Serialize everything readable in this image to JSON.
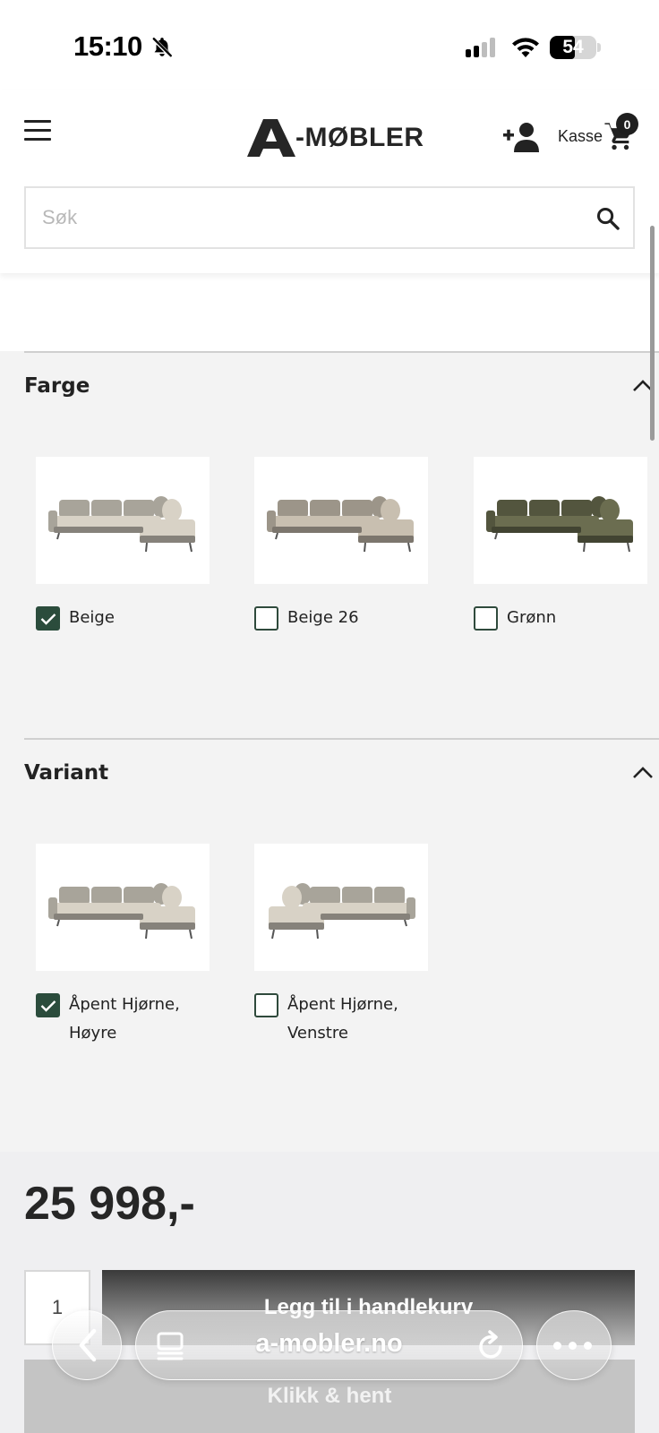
{
  "status_bar": {
    "time": "15:10",
    "battery": "54",
    "battery_level": 0.54
  },
  "header": {
    "logo_text": "-MØBLER",
    "kasse_label": "Kasse",
    "cart_count": "0",
    "search": {
      "placeholder": "Søk",
      "value": ""
    }
  },
  "sections": {
    "farge": {
      "title": "Farge",
      "options": [
        {
          "label": "Beige",
          "checked": true,
          "sofa_color": "#d8d2c6"
        },
        {
          "label": "Beige 26",
          "checked": false,
          "sofa_color": "#c8bfb0"
        },
        {
          "label": "Grønn",
          "checked": false,
          "sofa_color": "#6b6d50"
        }
      ]
    },
    "variant": {
      "title": "Variant",
      "options": [
        {
          "label": "Åpent Hjørne, Høyre",
          "checked": true
        },
        {
          "label": "Åpent Hjørne, Venstre",
          "checked": false
        }
      ]
    }
  },
  "purchase": {
    "price": "25 998,-",
    "quantity": "1",
    "add_to_cart_label": "Legg til i handlekurv",
    "pickup_label": "Klikk & hent"
  },
  "browser": {
    "url": "a-mobler.no"
  },
  "colors": {
    "accent_green": "#2b4c3c",
    "text_dark": "#222222"
  }
}
